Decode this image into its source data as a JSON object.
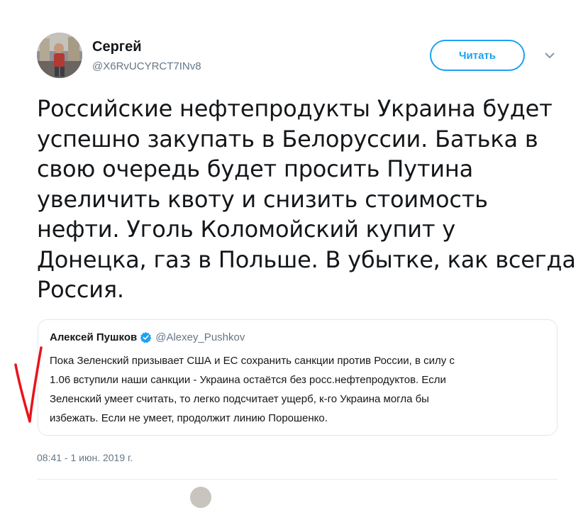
{
  "author": {
    "name": "Сергей",
    "handle": "@X6RvUCYRCT7INv8",
    "follow_label": "Читать",
    "more_icon": "chevron-down-icon"
  },
  "tweet": {
    "text_lines": [
      "Российские нефтепродукты Украина будет",
      "успешно закупать в Белоруссии. Батька в",
      "свою очередь будет просить Путина",
      "увеличить квоту и снизить стоимость",
      "нефти. Уголь Коломойский купит у",
      "Донецка, газ в Польше. В убытке, как всегда",
      "Россия."
    ],
    "timestamp": "08:41 - 1 июн. 2019 г."
  },
  "quoted_tweet": {
    "name": "Алексей Пушков",
    "verified": true,
    "handle": "@Alexey_Pushkov",
    "text_lines": [
      "Пока Зеленский призывает США и ЕС сохранить санкции против России, в силу с",
      "1.06 вступили наши санкции - Украина остаётся без росс.нефтепродуктов. Если",
      "Зеленский умеет считать, то легко подсчитает ущерб, к-го Украина могла бы",
      "избежать. Если не умеет, продолжит линию Порошенко."
    ]
  },
  "colors": {
    "accent": "#1da1f2",
    "text": "#14171a",
    "secondary_text": "#657786",
    "border": "#e1e8ed",
    "annotation": "#e8141b"
  }
}
